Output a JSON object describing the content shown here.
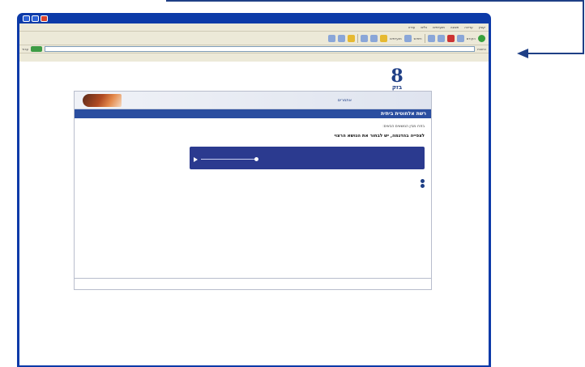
{
  "window": {
    "title": "",
    "menu": [
      "קובץ",
      "עריכה",
      "תצוגה",
      "מועדפים",
      "כלים",
      "עזרה"
    ],
    "toolbar": {
      "back_label": "הקודם",
      "search_label": "חיפוש",
      "favorites_label": "מועדפים"
    },
    "address": {
      "label": "כתובת",
      "value": "",
      "go_label": "עבור"
    }
  },
  "page": {
    "logo_text": "בזק",
    "banner_link": "אתמרים",
    "banner_tag": "",
    "header_title": "רשת אלחוטית ביתית",
    "intro": "בחרו מבין הנושאים הבאים:",
    "lead": "לצפייה בהדגמה, יש לבחור את הנושא הרצוי",
    "player": {
      "title": "",
      "subtitle": ""
    },
    "links": [
      {
        "label": ""
      },
      {
        "label": ""
      },
      {
        "label": ""
      }
    ]
  },
  "colors": {
    "brand": "#1f3f86",
    "header_bar": "#2a4ea0",
    "player_bg": "#2b3a8f",
    "window_frame": "#0c3aa8"
  }
}
